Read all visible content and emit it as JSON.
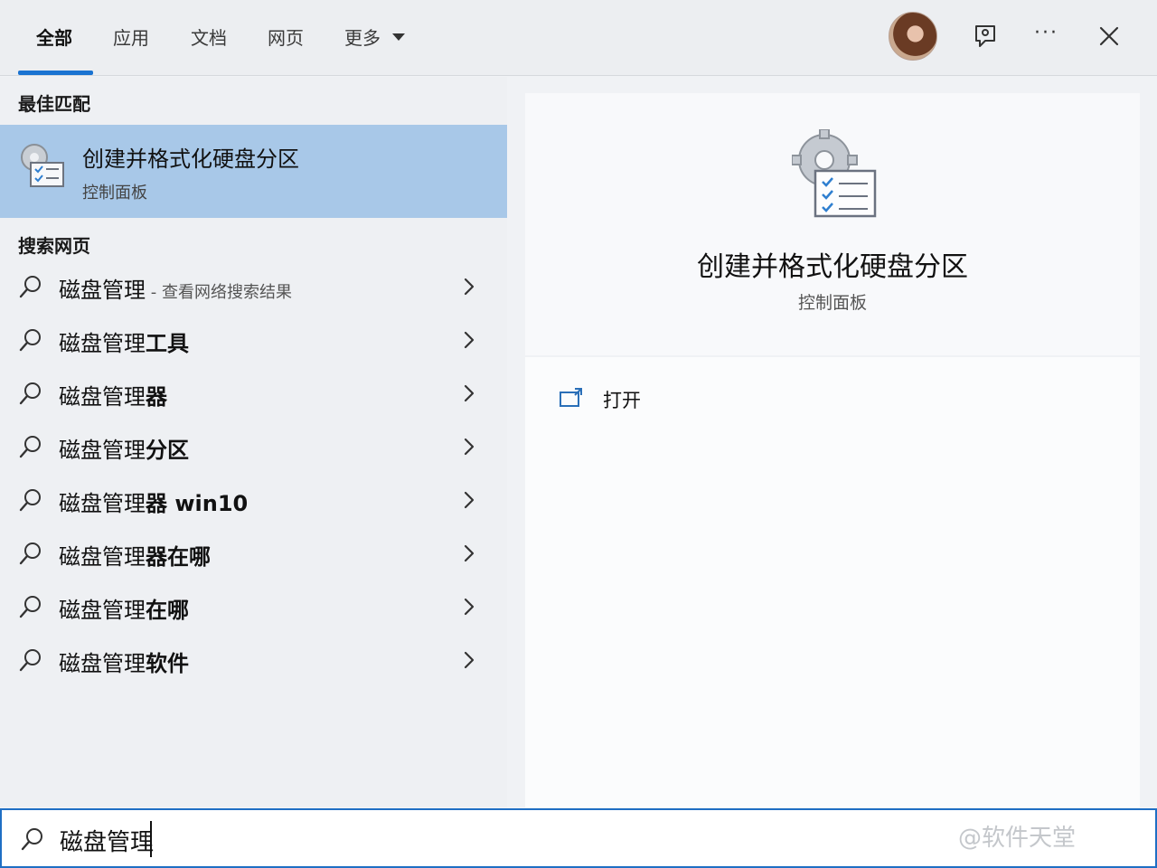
{
  "tabs": [
    {
      "label": "全部",
      "active": true
    },
    {
      "label": "应用",
      "active": false
    },
    {
      "label": "文档",
      "active": false
    },
    {
      "label": "网页",
      "active": false
    },
    {
      "label": "更多",
      "active": false
    }
  ],
  "topbar_icons": [
    "avatar",
    "feedback-icon",
    "more-options-icon",
    "close-icon"
  ],
  "more_label": "···",
  "best_match": {
    "section_title": "最佳匹配",
    "title": "创建并格式化硬盘分区",
    "subtitle": "控制面板"
  },
  "web_search": {
    "section_title": "搜索网页",
    "results": [
      {
        "prefix": "磁盘管理",
        "bold": "",
        "hint": " - 查看网络搜索结果"
      },
      {
        "prefix": "磁盘管理",
        "bold": "工具",
        "hint": ""
      },
      {
        "prefix": "磁盘管理",
        "bold": "器",
        "hint": ""
      },
      {
        "prefix": "磁盘管理",
        "bold": "分区",
        "hint": ""
      },
      {
        "prefix": "磁盘管理",
        "bold": "器 win10",
        "hint": ""
      },
      {
        "prefix": "磁盘管理",
        "bold": "器在哪",
        "hint": ""
      },
      {
        "prefix": "磁盘管理",
        "bold": "在哪",
        "hint": ""
      },
      {
        "prefix": "磁盘管理",
        "bold": "软件",
        "hint": ""
      }
    ]
  },
  "detail": {
    "title": "创建并格式化硬盘分区",
    "subtitle": "控制面板",
    "actions": [
      {
        "label": "打开",
        "icon": "open-window-icon"
      }
    ]
  },
  "search": {
    "value": "磁盘管理"
  },
  "watermark": "@软件天堂",
  "colors": {
    "accent": "#1a73d1",
    "selected_bg": "#a8c8e8",
    "panel_bg": "#eef0f3",
    "search_border": "#1f6fc4"
  }
}
